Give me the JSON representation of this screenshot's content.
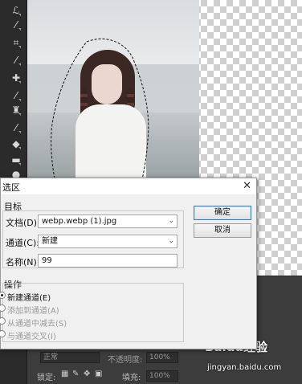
{
  "toolbar": {
    "tools": [
      {
        "icon": "lasso-icon",
        "glyph": "ℒ"
      },
      {
        "icon": "magic-wand-icon",
        "glyph": "⁄"
      },
      {
        "icon": "crop-icon",
        "glyph": "⌗"
      },
      {
        "icon": "eyedropper-icon",
        "glyph": "⁄"
      },
      {
        "icon": "healing-brush-icon",
        "glyph": "✚"
      },
      {
        "icon": "brush-icon",
        "glyph": "⁄"
      },
      {
        "icon": "clone-stamp-icon",
        "glyph": "♜"
      },
      {
        "icon": "history-brush-icon",
        "glyph": "⁄"
      },
      {
        "icon": "eraser-icon",
        "glyph": "◆"
      },
      {
        "icon": "gradient-icon",
        "glyph": "▬"
      },
      {
        "icon": "blur-icon",
        "glyph": "●"
      }
    ]
  },
  "dialog": {
    "title": "选区",
    "close_glyph": "✕",
    "target_group": "目标",
    "document_label": "文档(D):",
    "document_value": "webp.webp (1).jpg",
    "channel_label": "通道(C):",
    "channel_value": "新建",
    "name_label": "名称(N):",
    "name_value": "99",
    "operation_group": "操作",
    "operations": [
      {
        "label": "新建通道(E)",
        "selected": true,
        "enabled": true
      },
      {
        "label": "添加到通道(A)",
        "selected": false,
        "enabled": false
      },
      {
        "label": "从通道中减去(S)",
        "selected": false,
        "enabled": false
      },
      {
        "label": "与通道交叉(I)",
        "selected": false,
        "enabled": false
      }
    ],
    "ok_label": "确定",
    "cancel_label": "取消"
  },
  "layers_panel": {
    "blend_mode": "正常",
    "opacity_label": "不透明度:",
    "opacity_value": "100%",
    "lock_label": "锁定:",
    "fill_label": "填充:",
    "fill_value": "100%"
  },
  "watermark": {
    "brand": "Baidu经验",
    "url": "jingyan.baidu.com"
  }
}
